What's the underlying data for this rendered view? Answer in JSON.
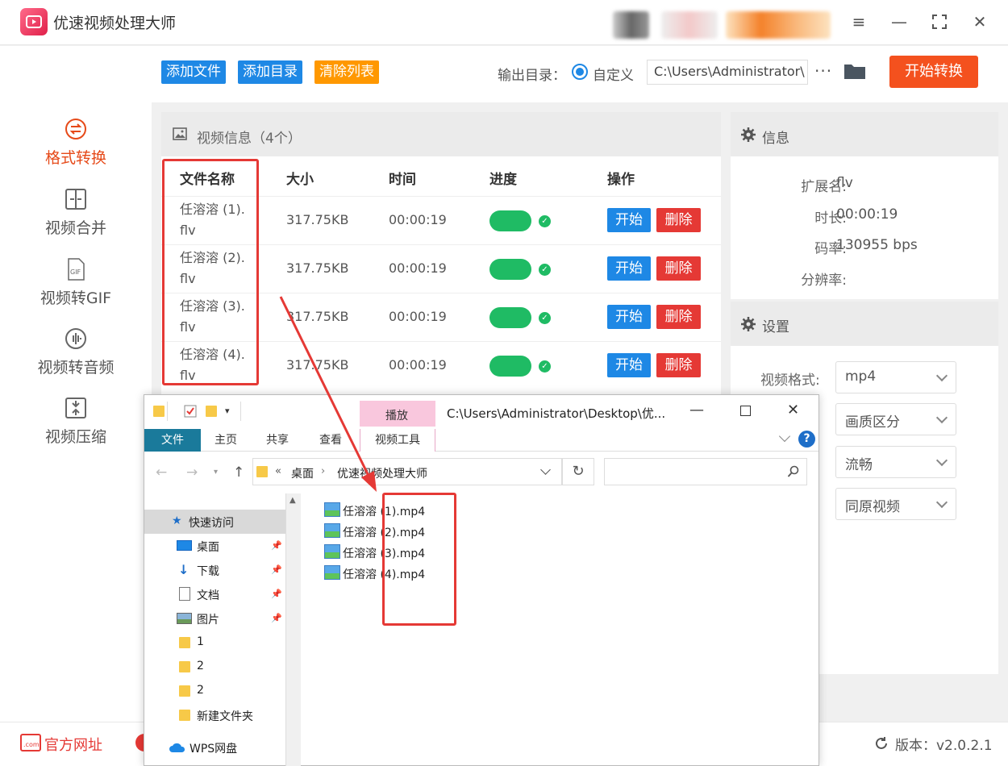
{
  "app": {
    "title": "优速视频处理大师"
  },
  "sidebar": {
    "items": [
      {
        "label": "格式转换",
        "active": true
      },
      {
        "label": "视频合并"
      },
      {
        "label": "视频转GIF"
      },
      {
        "label": "视频转音频"
      },
      {
        "label": "视频压缩"
      }
    ]
  },
  "toolbar": {
    "add_file": "添加文件",
    "add_dir": "添加目录",
    "clear_list": "清除列表",
    "output_label": "输出目录：",
    "output_option": "自定义",
    "output_path": "C:\\Users\\Administrator\\",
    "more": "···",
    "start_convert": "开始转换"
  },
  "video_panel": {
    "title": "视频信息（4个）",
    "columns": [
      "文件名称",
      "大小",
      "时间",
      "进度",
      "操作"
    ],
    "rows": [
      {
        "name_line1": "任溶溶 (1).",
        "name_line2": "flv",
        "size": "317.75KB",
        "time": "00:00:19",
        "start": "开始",
        "delete": "删除"
      },
      {
        "name_line1": "任溶溶 (2).",
        "name_line2": "flv",
        "size": "317.75KB",
        "time": "00:00:19",
        "start": "开始",
        "delete": "删除"
      },
      {
        "name_line1": "任溶溶 (3).",
        "name_line2": "flv",
        "size": "317.75KB",
        "time": "00:00:19",
        "start": "开始",
        "delete": "删除"
      },
      {
        "name_line1": "任溶溶 (4).",
        "name_line2": "flv",
        "size": "317.75KB",
        "time": "00:00:19",
        "start": "开始",
        "delete": "删除"
      }
    ]
  },
  "info_panel": {
    "title": "信息",
    "ext_label": "扩展名:",
    "ext_value": "flv",
    "duration_label": "时长:",
    "duration_value": "00:00:19",
    "bitrate_label": "码率:",
    "bitrate_value": "130955 bps",
    "resolution_label": "分辨率:",
    "resolution_value": ""
  },
  "settings_panel": {
    "title": "设置",
    "format_label": "视频格式:",
    "format_value": "mp4",
    "quality_value": "画质区分",
    "fluency_value": "流畅",
    "source_value": "同原视频"
  },
  "bottom": {
    "official_site": "官方网址",
    "version": "版本：v2.0.2.1"
  },
  "explorer": {
    "title": "C:\\Users\\Administrator\\Desktop\\优...",
    "play_tab": "播放",
    "tabs": [
      "文件",
      "主页",
      "共享",
      "查看",
      "视频工具"
    ],
    "breadcrumb_root": "«",
    "breadcrumb_1": "桌面",
    "breadcrumb_2": "优速视频处理大师",
    "nav": [
      "快速访问",
      "桌面",
      "下载",
      "文档",
      "图片",
      "1",
      "2",
      "2",
      "新建文件夹",
      "WPS网盘"
    ],
    "files": [
      "任溶溶 (1).mp4",
      "任溶溶 (2).mp4",
      "任溶溶 (3).mp4",
      "任溶溶 (4).mp4"
    ]
  },
  "colors": {
    "accent_orange": "#f4511e",
    "primary_blue": "#1e88e5",
    "danger_red": "#e53935",
    "progress_green": "#1fbb64",
    "clear_orange": "#ff9800",
    "annotation_red": "#e53935"
  }
}
